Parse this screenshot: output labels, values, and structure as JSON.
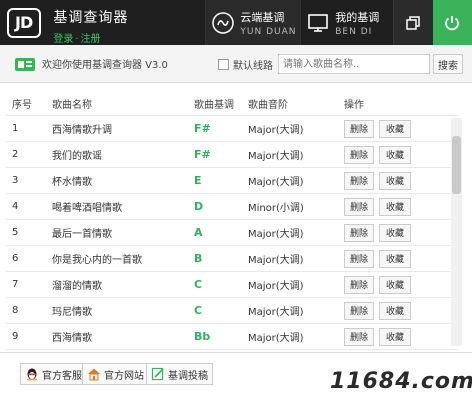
{
  "header": {
    "logo_text": "JD",
    "app_title": "基调查询器",
    "login_label": "登录",
    "register_label": "注册",
    "nav": [
      {
        "cn": "云端基调",
        "en": "YUN DUAN",
        "icon": "cloud-tune-icon"
      },
      {
        "cn": "我的基调",
        "en": "BEN DI",
        "icon": "monitor-icon"
      }
    ],
    "restore_icon": "restore-window-icon",
    "power_icon": "power-icon",
    "accent_color": "#3bb35a"
  },
  "toolbar": {
    "welcome_text": "欢迎你使用基调查询器 V3.0",
    "default_route_label": "默认线路",
    "default_route_checked": false,
    "search_placeholder": "请输入歌曲名称..",
    "search_button": "搜索"
  },
  "table": {
    "columns": [
      "序号",
      "歌曲名称",
      "歌曲基调",
      "歌曲音阶",
      "操作"
    ],
    "delete_label": "删除",
    "favorite_label": "收藏",
    "rows": [
      {
        "idx": "1",
        "name": "西海情歌升调",
        "key": "F#",
        "scale": "Major(大调)"
      },
      {
        "idx": "2",
        "name": "我们的歌谣",
        "key": "F#",
        "scale": "Major(大调)"
      },
      {
        "idx": "3",
        "name": "杯水情歌",
        "key": "E",
        "scale": "Major(大调)"
      },
      {
        "idx": "4",
        "name": "喝着啤酒唱情歌",
        "key": "D",
        "scale": "Minor(小调)"
      },
      {
        "idx": "5",
        "name": "最后一首情歌",
        "key": "A",
        "scale": "Major(大调)"
      },
      {
        "idx": "6",
        "name": "你是我心内的一首歌",
        "key": "B",
        "scale": "Major(大调)"
      },
      {
        "idx": "7",
        "name": "溜溜的情歌",
        "key": "C",
        "scale": "Major(大调)"
      },
      {
        "idx": "8",
        "name": "玛尼情歌",
        "key": "C",
        "scale": "Major(大调)"
      },
      {
        "idx": "9",
        "name": "西海情歌",
        "key": "Bb",
        "scale": "Major(大调)"
      }
    ],
    "scroll_position": 0.06
  },
  "footer": {
    "buttons": [
      {
        "label": "官方客服",
        "icon": "qq-penguin-icon"
      },
      {
        "label": "官方网站",
        "icon": "home-icon"
      },
      {
        "label": "基调投稿",
        "icon": "edit-icon"
      }
    ],
    "watermark": "11684.com"
  }
}
